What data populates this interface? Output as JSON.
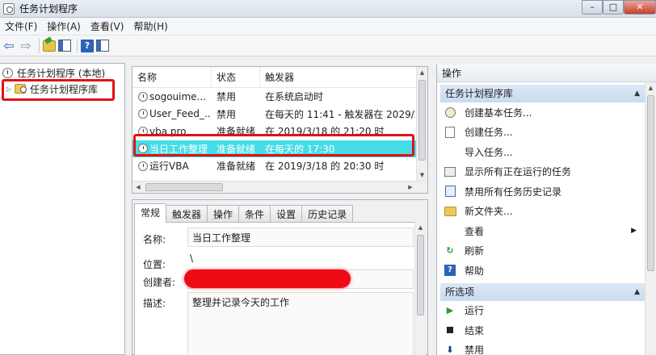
{
  "window": {
    "title": "任务计划程序",
    "controls": {
      "minimize": "–",
      "maximize": "□",
      "close": "✕"
    }
  },
  "menu": {
    "items": [
      "文件(F)",
      "操作(A)",
      "查看(V)",
      "帮助(H)"
    ]
  },
  "tree": {
    "root_label": "任务计划程序 (本地)",
    "child_label": "任务计划程序库"
  },
  "task_list": {
    "columns": [
      "名称",
      "状态",
      "触发器"
    ],
    "rows": [
      {
        "name": "sogouime...",
        "status": "禁用",
        "trigger": "在系统启动时"
      },
      {
        "name": "User_Feed_...",
        "status": "禁用",
        "trigger": "在每天的 11:41 - 触发器在 2029/2"
      },
      {
        "name": "vba pro",
        "status": "准备就绪",
        "trigger": "在 2019/3/18 的 21:20 时"
      },
      {
        "name": "当日工作整理",
        "status": "准备就绪",
        "trigger": "在每天的 17:30"
      },
      {
        "name": "运行VBA",
        "status": "准备就绪",
        "trigger": "在 2019/3/18 的 20:30 时"
      }
    ],
    "selected_index": 3
  },
  "details": {
    "tabs": [
      "常规",
      "触发器",
      "操作",
      "条件",
      "设置",
      "历史记录"
    ],
    "active_tab": "常规",
    "name_label": "名称:",
    "name_value": "当日工作整理",
    "location_label": "位置:",
    "location_value": "\\",
    "author_label": "创建者:",
    "description_label": "描述:",
    "description_value": "整理并记录今天的工作"
  },
  "actions": {
    "header": "操作",
    "section1": {
      "title": "任务计划程序库",
      "items": [
        {
          "label": "创建基本任务...",
          "icon": "create-basic-task-icon"
        },
        {
          "label": "创建任务...",
          "icon": "create-task-icon"
        },
        {
          "label": "导入任务...",
          "icon": ""
        },
        {
          "label": "显示所有正在运行的任务",
          "icon": "running-tasks-icon"
        },
        {
          "label": "禁用所有任务历史记录",
          "icon": "history-icon"
        },
        {
          "label": "新文件夹...",
          "icon": "new-folder-icon"
        },
        {
          "label": "查看",
          "icon": "",
          "submenu": true
        },
        {
          "label": "刷新",
          "icon": "refresh-icon"
        },
        {
          "label": "帮助",
          "icon": "help-icon"
        }
      ]
    },
    "section2": {
      "title": "所选项",
      "items": [
        {
          "label": "运行",
          "icon": "run-icon"
        },
        {
          "label": "结束",
          "icon": "stop-icon"
        },
        {
          "label": "禁用",
          "icon": "disable-icon"
        }
      ]
    }
  },
  "colors": {
    "selection": "#45dde9",
    "annotation_red": "#e21212",
    "section_header": "#c9dbf1"
  }
}
